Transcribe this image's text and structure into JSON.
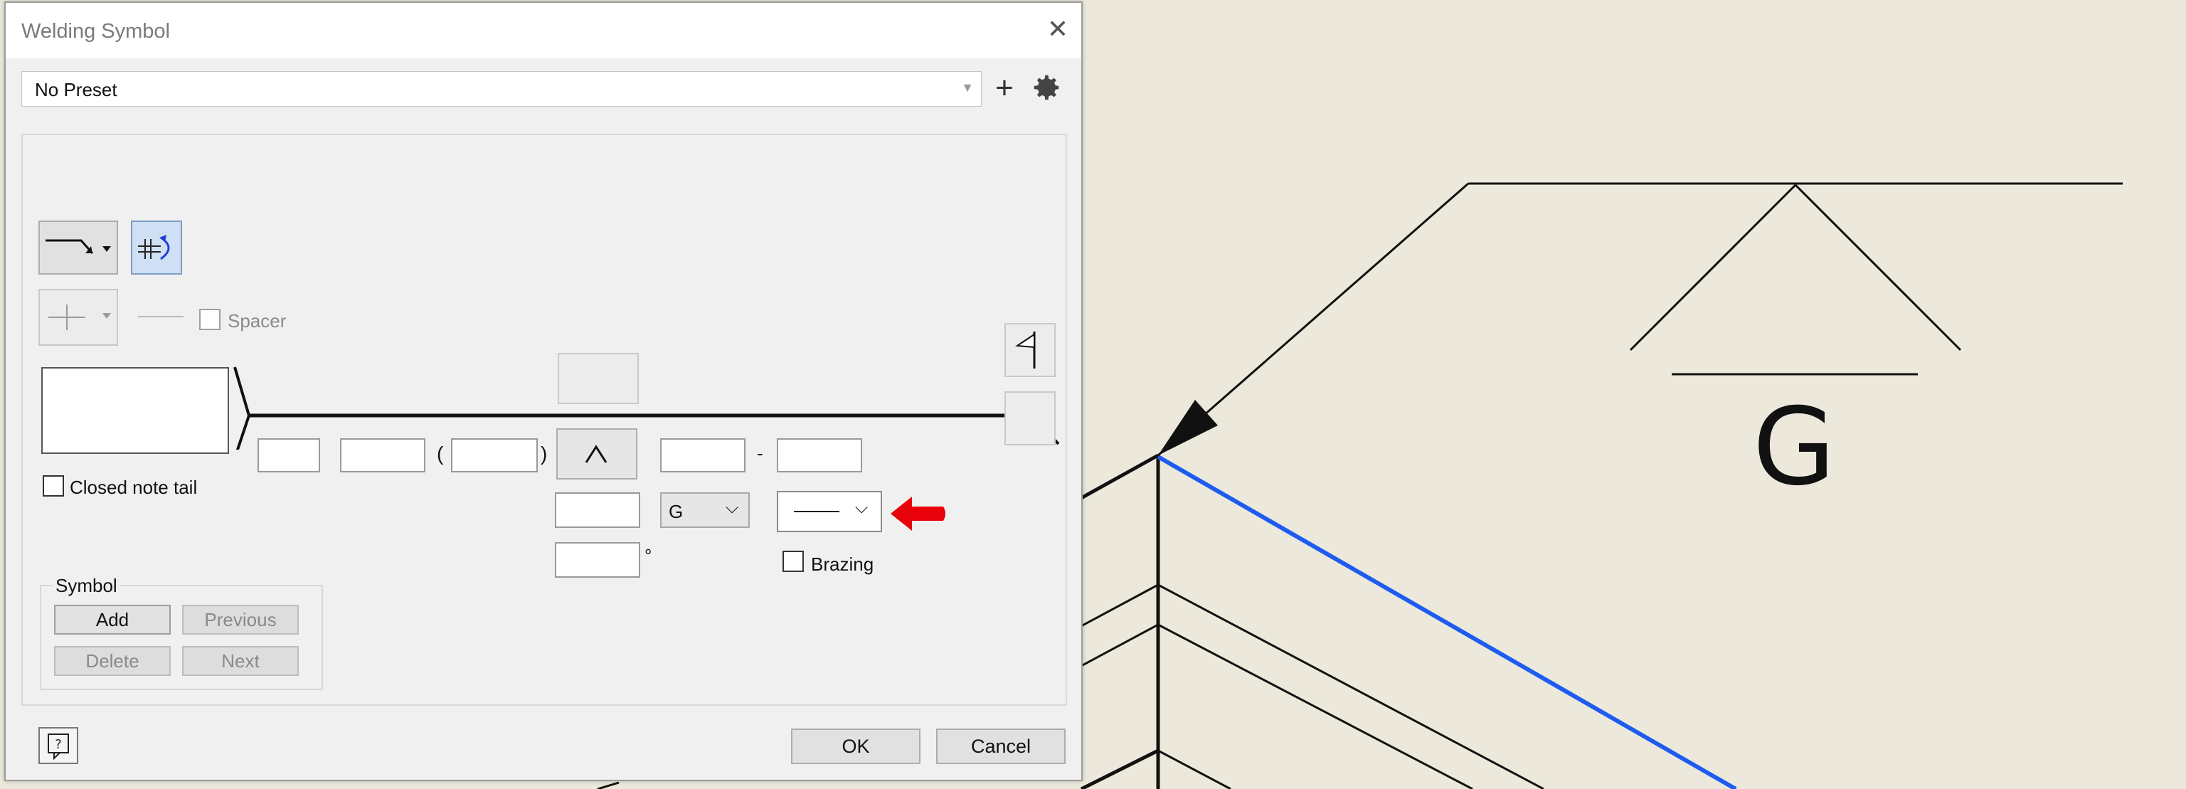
{
  "dialog": {
    "title": "Welding Symbol",
    "preset": "No Preset",
    "spacer_label": "Spacer",
    "closed_note_tail_label": "Closed note tail",
    "paren_open": "(",
    "paren_close": ")",
    "dash": "-",
    "contour_value": "G",
    "degree": "°",
    "brazing_label": "Brazing",
    "symbol_group": {
      "label": "Symbol",
      "add": "Add",
      "previous": "Previous",
      "delete": "Delete",
      "next": "Next"
    },
    "ok": "OK",
    "cancel": "Cancel"
  },
  "annotation": {
    "arrow_color": "#e8000b"
  },
  "drawing": {
    "symbol_letter": "G",
    "highlight_color": "#1e5cf0"
  }
}
